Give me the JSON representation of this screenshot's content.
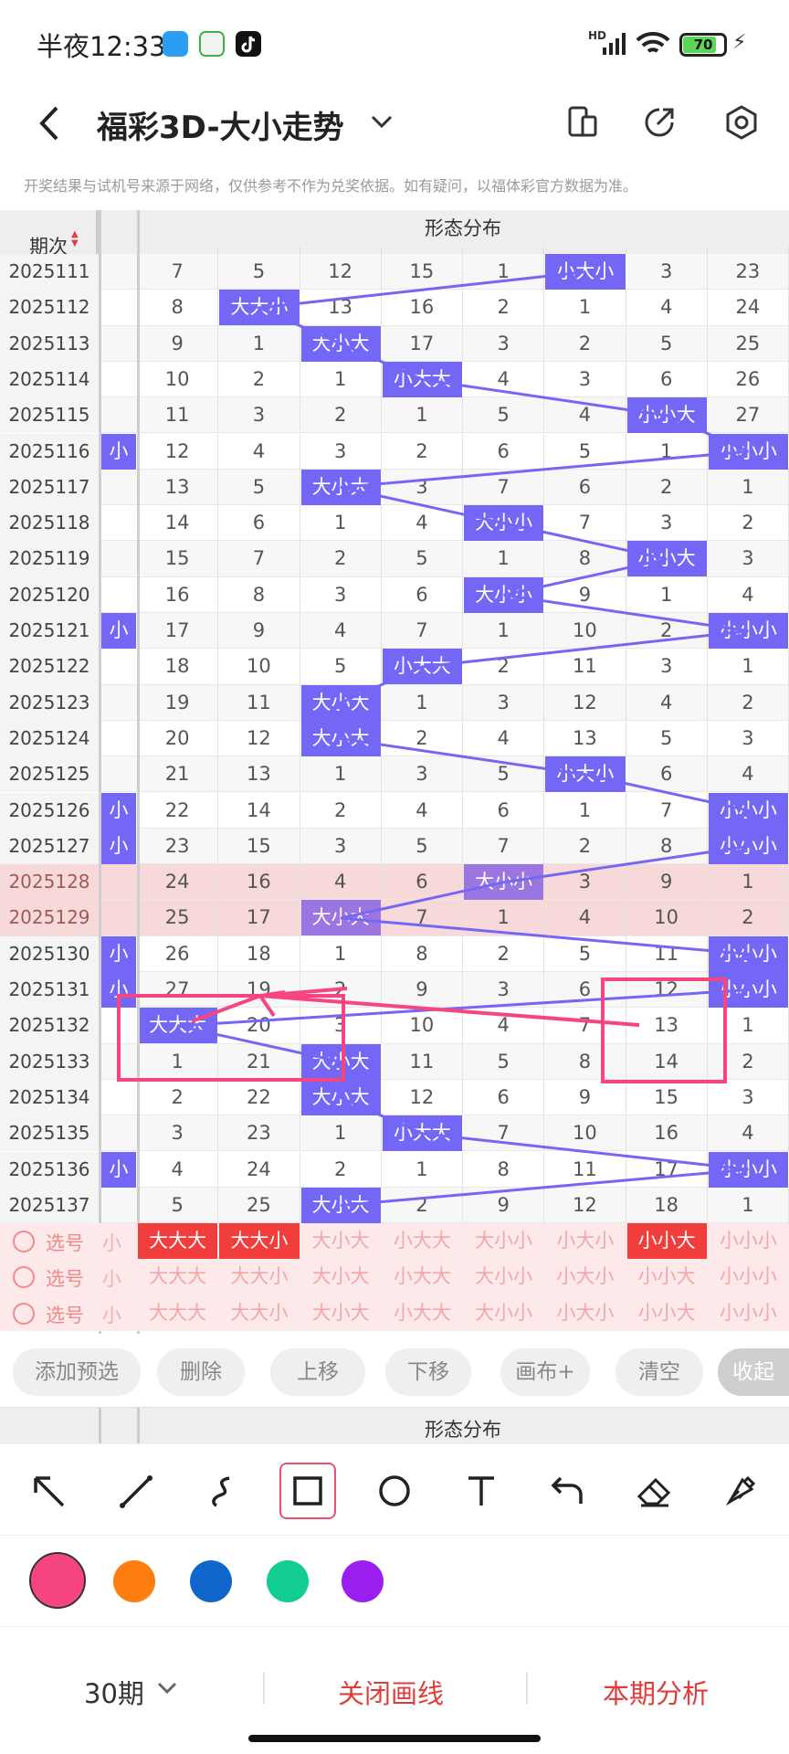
{
  "status": {
    "time": "半夜12:33",
    "network": "HD",
    "battery": "70"
  },
  "header": {
    "title": "福彩3D-大小走势",
    "disclaimer": "开奖结果与试机号来源于网络，仅供参考不作为兑奖依据。如有疑问，以福体彩官方数据为准。"
  },
  "table": {
    "issue_header": "期次",
    "group_header": "形态分布",
    "left_partial_label": "小",
    "columns": [
      "大大大",
      "大大小",
      "大小大",
      "小大大",
      "大小小",
      "小大小",
      "小小大",
      "小小小"
    ],
    "rows": [
      {
        "issue": "2025111",
        "cells": [
          "7",
          "5",
          "12",
          "15",
          "1",
          "小大小",
          "3",
          "23"
        ]
      },
      {
        "issue": "2025112",
        "cells": [
          "8",
          "大大小",
          "13",
          "16",
          "2",
          "1",
          "4",
          "24"
        ]
      },
      {
        "issue": "2025113",
        "cells": [
          "9",
          "1",
          "大小大",
          "17",
          "3",
          "2",
          "5",
          "25"
        ]
      },
      {
        "issue": "2025114",
        "cells": [
          "10",
          "2",
          "1",
          "小大大",
          "4",
          "3",
          "6",
          "26"
        ]
      },
      {
        "issue": "2025115",
        "cells": [
          "11",
          "3",
          "2",
          "1",
          "5",
          "4",
          "小小大",
          "27"
        ]
      },
      {
        "issue": "2025116",
        "cells": [
          "12",
          "4",
          "3",
          "2",
          "6",
          "5",
          "1",
          "小小小"
        ]
      },
      {
        "issue": "2025117",
        "cells": [
          "13",
          "5",
          "大小大",
          "3",
          "7",
          "6",
          "2",
          "1"
        ]
      },
      {
        "issue": "2025118",
        "cells": [
          "14",
          "6",
          "1",
          "4",
          "大小小",
          "7",
          "3",
          "2"
        ]
      },
      {
        "issue": "2025119",
        "cells": [
          "15",
          "7",
          "2",
          "5",
          "1",
          "8",
          "小小大",
          "3"
        ]
      },
      {
        "issue": "2025120",
        "cells": [
          "16",
          "8",
          "3",
          "6",
          "大小小",
          "9",
          "1",
          "4"
        ]
      },
      {
        "issue": "2025121",
        "cells": [
          "17",
          "9",
          "4",
          "7",
          "1",
          "10",
          "2",
          "小小小"
        ]
      },
      {
        "issue": "2025122",
        "cells": [
          "18",
          "10",
          "5",
          "小大大",
          "2",
          "11",
          "3",
          "1"
        ]
      },
      {
        "issue": "2025123",
        "cells": [
          "19",
          "11",
          "大小大",
          "1",
          "3",
          "12",
          "4",
          "2"
        ]
      },
      {
        "issue": "2025124",
        "cells": [
          "20",
          "12",
          "大小大",
          "2",
          "4",
          "13",
          "5",
          "3"
        ]
      },
      {
        "issue": "2025125",
        "cells": [
          "21",
          "13",
          "1",
          "3",
          "5",
          "小大小",
          "6",
          "4"
        ]
      },
      {
        "issue": "2025126",
        "cells": [
          "22",
          "14",
          "2",
          "4",
          "6",
          "1",
          "7",
          "小小小"
        ]
      },
      {
        "issue": "2025127",
        "cells": [
          "23",
          "15",
          "3",
          "5",
          "7",
          "2",
          "8",
          "小小小"
        ]
      },
      {
        "issue": "2025128",
        "cells": [
          "24",
          "16",
          "4",
          "6",
          "大小小",
          "3",
          "9",
          "1"
        ]
      },
      {
        "issue": "2025129",
        "cells": [
          "25",
          "17",
          "大小大",
          "7",
          "1",
          "4",
          "10",
          "2"
        ]
      },
      {
        "issue": "2025130",
        "cells": [
          "26",
          "18",
          "1",
          "8",
          "2",
          "5",
          "11",
          "小小小"
        ]
      },
      {
        "issue": "2025131",
        "cells": [
          "27",
          "19",
          "2",
          "9",
          "3",
          "6",
          "12",
          "小小小"
        ]
      },
      {
        "issue": "2025132",
        "cells": [
          "大大大",
          "20",
          "3",
          "10",
          "4",
          "7",
          "13",
          "1"
        ]
      },
      {
        "issue": "2025133",
        "cells": [
          "1",
          "21",
          "大小大",
          "11",
          "5",
          "8",
          "14",
          "2"
        ]
      },
      {
        "issue": "2025134",
        "cells": [
          "2",
          "22",
          "大小大",
          "12",
          "6",
          "9",
          "15",
          "3"
        ]
      },
      {
        "issue": "2025135",
        "cells": [
          "3",
          "23",
          "1",
          "小大大",
          "7",
          "10",
          "16",
          "4"
        ]
      },
      {
        "issue": "2025136",
        "cells": [
          "4",
          "24",
          "2",
          "1",
          "8",
          "11",
          "17",
          "小小小"
        ]
      },
      {
        "issue": "2025137",
        "cells": [
          "5",
          "25",
          "大小大",
          "2",
          "9",
          "12",
          "18",
          "1"
        ]
      }
    ],
    "select_label": "选号",
    "footer_group_header": "形态分布"
  },
  "actions": [
    "添加预选",
    "删除",
    "上移",
    "下移",
    "画布+",
    "清空",
    "收起"
  ],
  "tools": [
    "arrow-tool",
    "line-tool",
    "curve-tool",
    "rectangle-tool",
    "circle-tool",
    "text-tool",
    "undo-tool",
    "eraser-tool",
    "clear-tool"
  ],
  "colors": [
    "#f7467f",
    "#ff7d0f",
    "#1166cc",
    "#12cc91",
    "#9a1ef0"
  ],
  "bottom": {
    "period": "30期",
    "close_lines": "关闭画线",
    "analysis": "本期分析"
  },
  "accent": {
    "ball": "#7567f5",
    "highlight_row": "#f8d9da",
    "selected": "#f23d3d",
    "text_red": "#e13c3c"
  }
}
